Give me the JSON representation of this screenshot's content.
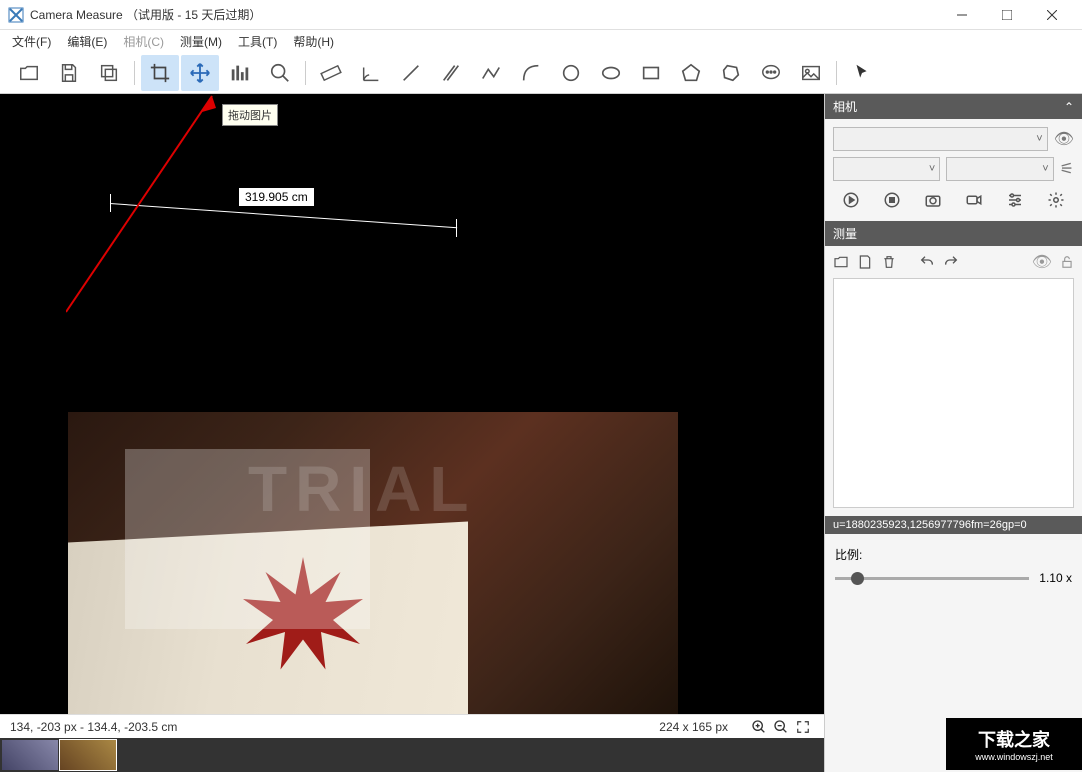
{
  "title": "Camera Measure （试用版 - 15 天后过期）",
  "menu": [
    "文件(F)",
    "编辑(E)",
    "相机(C)",
    "测量(M)",
    "工具(T)",
    "帮助(H)"
  ],
  "menu_disabled_index": 2,
  "tooltip": "拖动图片",
  "measurement_value": "319.905 cm",
  "status": {
    "coords": "134, -203 px - 134.4, -203.5 cm",
    "size": "224 x 165 px"
  },
  "panels": {
    "camera": {
      "title": "相机"
    },
    "measure": {
      "title": "测量"
    }
  },
  "info_strip": "u=1880235923,1256977796fm=26gp=0",
  "scale": {
    "label": "比例:",
    "value": "1.10 x"
  },
  "trial_text": "TRIAL",
  "watermark": {
    "main": "下载之家",
    "sub": "www.windowszj.net"
  }
}
